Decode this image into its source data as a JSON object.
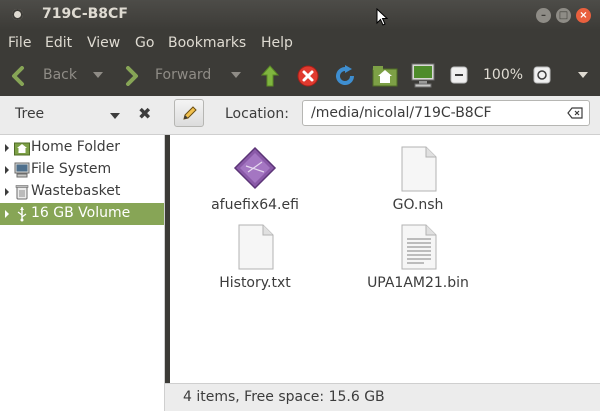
{
  "window": {
    "title": "719C-B8CF"
  },
  "menu": {
    "items": [
      "File",
      "Edit",
      "View",
      "Go",
      "Bookmarks",
      "Help"
    ]
  },
  "toolbar": {
    "back_label": "Back",
    "forward_label": "Forward",
    "zoom": "100%",
    "icons": [
      "back-arrow-icon",
      "forward-arrow-icon",
      "up-arrow-icon",
      "stop-icon",
      "reload-icon",
      "home-icon",
      "computer-icon",
      "zoom-out-icon",
      "zoom-in-icon"
    ]
  },
  "locationbar": {
    "sidebar_mode": "Tree",
    "location_label": "Location:",
    "location_value": "/media/nicolal/719C-B8CF"
  },
  "sidebar": {
    "items": [
      {
        "label": "Home Folder",
        "icon": "home-folder-icon",
        "selected": false
      },
      {
        "label": "File System",
        "icon": "file-system-icon",
        "selected": false
      },
      {
        "label": "Wastebasket",
        "icon": "wastebasket-icon",
        "selected": false
      },
      {
        "label": "16 GB Volume",
        "icon": "usb-drive-icon",
        "selected": true
      }
    ]
  },
  "files": [
    {
      "name": "afuefix64.efi",
      "icon": "efi-file-icon"
    },
    {
      "name": "GO.nsh",
      "icon": "blank-file-icon"
    },
    {
      "name": "History.txt",
      "icon": "blank-file-icon"
    },
    {
      "name": "UPA1AM21.bin",
      "icon": "text-file-icon"
    }
  ],
  "status": {
    "text": "4 items, Free space: 15.6 GB"
  },
  "colors": {
    "selection": "#87a556",
    "titlebar": "#3c3b37",
    "close_button": "#e9603e"
  }
}
